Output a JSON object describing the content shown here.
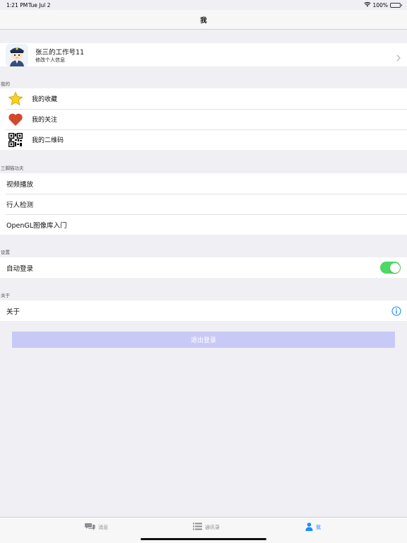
{
  "status_bar": {
    "time": "1:21 PM",
    "date": "Tue Jul 2",
    "battery": "100%"
  },
  "nav": {
    "title": "我"
  },
  "profile": {
    "name": "张三的工作号11",
    "subtitle": "修改个人信息"
  },
  "sections": {
    "mine": {
      "header": "我的",
      "items": [
        {
          "label": "我的收藏",
          "icon": "star-icon"
        },
        {
          "label": "我的关注",
          "icon": "heart-icon"
        },
        {
          "label": "我的二维码",
          "icon": "qrcode-icon"
        }
      ]
    },
    "kungfu": {
      "header": "三脚猫功夫",
      "items": [
        {
          "label": "视频播放"
        },
        {
          "label": "行人检测"
        },
        {
          "label": "OpenGL图像库入门"
        }
      ]
    },
    "settings": {
      "header": "设置",
      "auto_login_label": "自动登录",
      "auto_login_on": true
    },
    "about": {
      "header": "关于",
      "label": "关于"
    }
  },
  "logout_label": "退出登录",
  "tabs": [
    {
      "label": "消息",
      "icon": "chat-bubbles-icon",
      "active": false
    },
    {
      "label": "通讯录",
      "icon": "list-icon",
      "active": false
    },
    {
      "label": "我",
      "icon": "person-icon",
      "active": true
    }
  ],
  "colors": {
    "accent": "#1a8cff",
    "switch_on": "#4cd964",
    "logout_button": "#c9c9f7",
    "background": "#efeff4"
  }
}
